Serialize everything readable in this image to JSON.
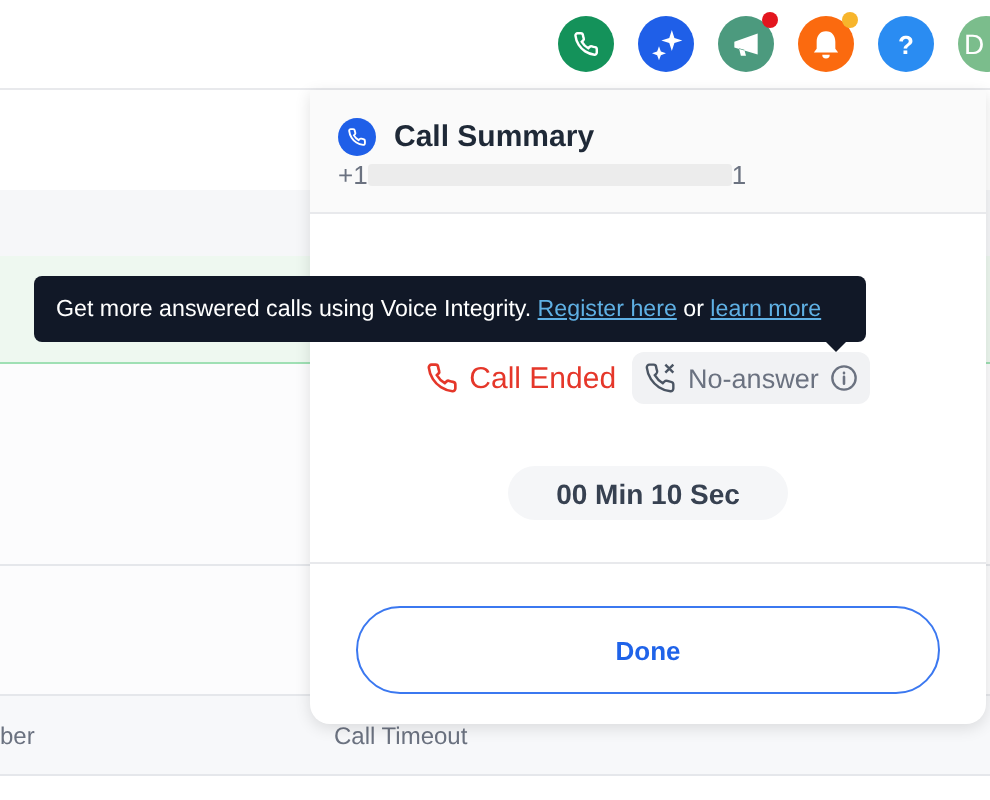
{
  "toolbar": {
    "buttons": [
      {
        "kind": "phone",
        "color": "#14925a"
      },
      {
        "kind": "sparkle",
        "color": "#1f5fe8"
      },
      {
        "kind": "megaphone",
        "color": "#4c9a7e",
        "notification_dot": {
          "color": "#e3161e"
        }
      },
      {
        "kind": "bell",
        "color": "#fb6a0f",
        "notification_dot": {
          "color": "#f7b52c"
        }
      },
      {
        "kind": "help",
        "color": "#2a8cf2",
        "text": "?"
      },
      {
        "kind": "avatar",
        "color": "#7bbd8c",
        "text": "D"
      }
    ]
  },
  "table": {
    "columns": [
      "ber",
      "Call Timeout"
    ]
  },
  "call_summary": {
    "title": "Call Summary",
    "number_prefix": "+1",
    "number_suffix": "1",
    "status": "Call Ended",
    "outcome": "No-answer",
    "duration": "00 Min 10 Sec",
    "done_button": "Done"
  },
  "tooltip": {
    "parts": [
      {
        "kind": "text",
        "text": "Get more answered calls using Voice Integrity. "
      },
      {
        "kind": "link",
        "text": "Register here"
      },
      {
        "kind": "text",
        "text": " or "
      },
      {
        "kind": "link",
        "text": "learn more"
      }
    ]
  }
}
